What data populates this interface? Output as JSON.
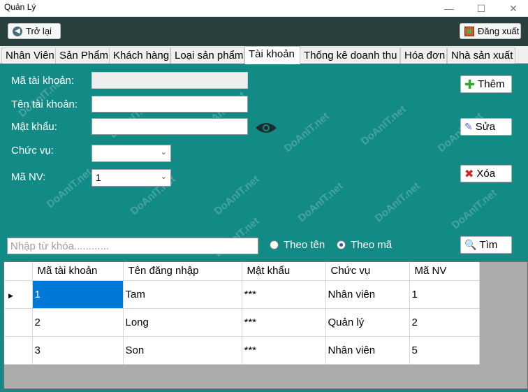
{
  "window": {
    "title": "Quản Lý",
    "minimize_glyph": "—",
    "maximize_glyph": "☐",
    "close_glyph": "✕"
  },
  "header": {
    "back_label": "Trở lại",
    "logout_label": "Đăng xuất"
  },
  "tabs": [
    "Nhân Viên",
    "Sản Phẩm",
    "Khách hàng",
    "Loại sản phẩm",
    "Tài khoản",
    "Thống kê doanh thu",
    "Hóa đơn",
    "Nhà sản xuất"
  ],
  "active_tab": "Tài khoản",
  "form": {
    "account_id_label": "Mã tài khoản:",
    "account_id_value": "",
    "username_label": "Tên tài khoản:",
    "username_value": "",
    "password_label": "Mật khẩu:",
    "password_value": "",
    "role_label": "Chức vụ:",
    "role_value": "",
    "employee_id_label": "Mã NV:",
    "employee_id_value": "1"
  },
  "actions": {
    "add_label": "Thêm",
    "edit_label": "Sửa",
    "delete_label": "Xóa",
    "find_label": "Tìm"
  },
  "search": {
    "placeholder": "Nhập từ khóa............",
    "value": "",
    "radio_by_name": "Theo tên",
    "radio_by_id": "Theo mã",
    "selected": "Theo mã"
  },
  "watermark": "DoAnIT.net",
  "table": {
    "columns": [
      "Mã tài khoản",
      "Tên đăng nhập",
      "Mật khẩu",
      "Chức vụ",
      "Mã NV"
    ],
    "rows": [
      [
        "1",
        "Tam",
        "***",
        "Nhân viên",
        "1"
      ],
      [
        "2",
        "Long",
        "***",
        "Quản lý",
        "2"
      ],
      [
        "3",
        "Son",
        "***",
        "Nhân viên",
        "5"
      ]
    ],
    "selected_row": 0
  },
  "colors": {
    "panel": "#128a86",
    "header": "#29403e",
    "selection": "#0078d7"
  }
}
